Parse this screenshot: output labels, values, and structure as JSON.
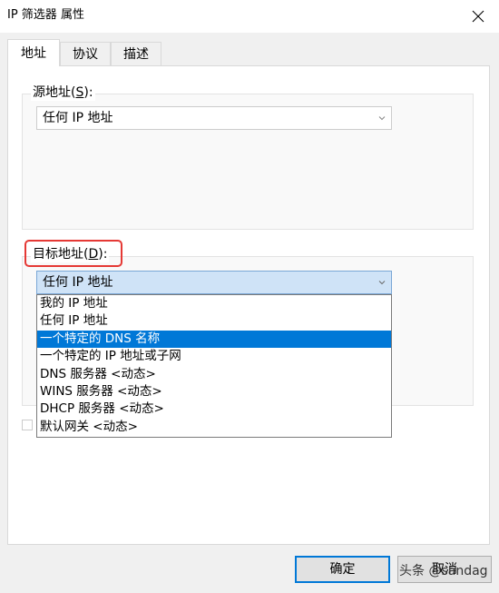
{
  "window": {
    "title": "IP 筛选器 属性",
    "close_icon": "close-icon"
  },
  "tabs": [
    {
      "label": "地址",
      "active": true
    },
    {
      "label": "协议",
      "active": false
    },
    {
      "label": "描述",
      "active": false
    }
  ],
  "source": {
    "label_text": "源地址(",
    "label_accel": "S",
    "label_tail": "):",
    "selected": "任何 IP 地址"
  },
  "destination": {
    "label_text": "目标地址(",
    "label_accel": "D",
    "label_tail": "):",
    "selected": "任何 IP 地址",
    "dropdown_options": [
      "我的 IP 地址",
      "任何 IP 地址",
      "一个特定的 DNS 名称",
      "一个特定的 IP 地址或子网",
      "DNS 服务器 <动态>",
      "WINS 服务器 <动态>",
      "DHCP 服务器 <动态>",
      "默认网关 <动态>"
    ],
    "highlighted_index": 2
  },
  "buttons": {
    "ok_label": "确定",
    "cancel_label": "取消"
  },
  "watermark": "头条 @sandag",
  "colors": {
    "highlight": "#0078d7",
    "annotation_red": "#e53935",
    "focus_combo": "#cfe3f7"
  }
}
